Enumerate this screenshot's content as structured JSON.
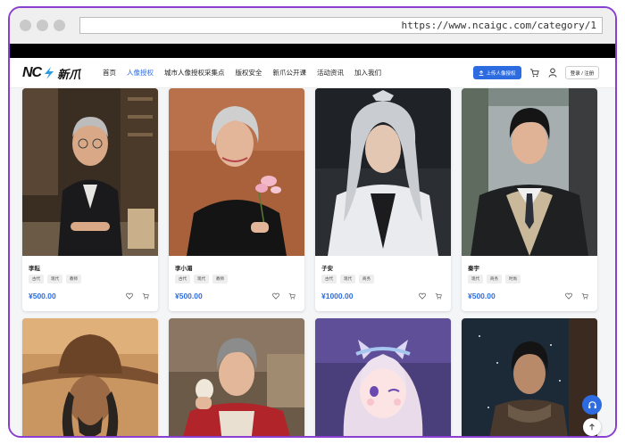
{
  "browser": {
    "url": "https://www.ncaigc.com/category/1"
  },
  "header": {
    "logo_text_latin": "NC",
    "logo_text_cn": "新爪",
    "menu": [
      {
        "label": "首页",
        "active": false
      },
      {
        "label": "人像授权",
        "active": true
      },
      {
        "label": "城市人像授权采集点",
        "active": false
      },
      {
        "label": "版权安全",
        "active": false
      },
      {
        "label": "新爪公开课",
        "active": false
      },
      {
        "label": "活动资讯",
        "active": false
      },
      {
        "label": "加入我们",
        "active": false
      }
    ],
    "upload_label": "上传人像授权",
    "login_label": "登录 / 注册"
  },
  "cards": [
    {
      "name": "李耘",
      "tags": [
        "古代",
        "现代",
        "教师"
      ],
      "price": "¥500.00",
      "image": "elderly-man-in-suit-library"
    },
    {
      "name": "李小湄",
      "tags": [
        "古代",
        "现代",
        "教师"
      ],
      "price": "¥500.00",
      "image": "grey-haired-woman-holding-flower"
    },
    {
      "name": "子安",
      "tags": [
        "古代",
        "现代",
        "商务"
      ],
      "price": "¥1000.00",
      "image": "silver-haired-ancient-costume-man"
    },
    {
      "name": "秦宇",
      "tags": [
        "现代",
        "商务",
        "时尚"
      ],
      "price": "¥500.00",
      "image": "young-man-in-school-uniform"
    }
  ],
  "row2_images": [
    "cowboy-hat-man",
    "elderly-woman-baker",
    "anime-girl-cat-ears",
    "woman-in-snow"
  ],
  "colors": {
    "accent": "#2d6be0",
    "frame": "#8a3fd0"
  },
  "icons": {
    "cart": "cart-icon",
    "user": "user-icon",
    "heart": "heart-icon",
    "support": "headset-icon",
    "back_to_top": "arrow-up-icon"
  }
}
